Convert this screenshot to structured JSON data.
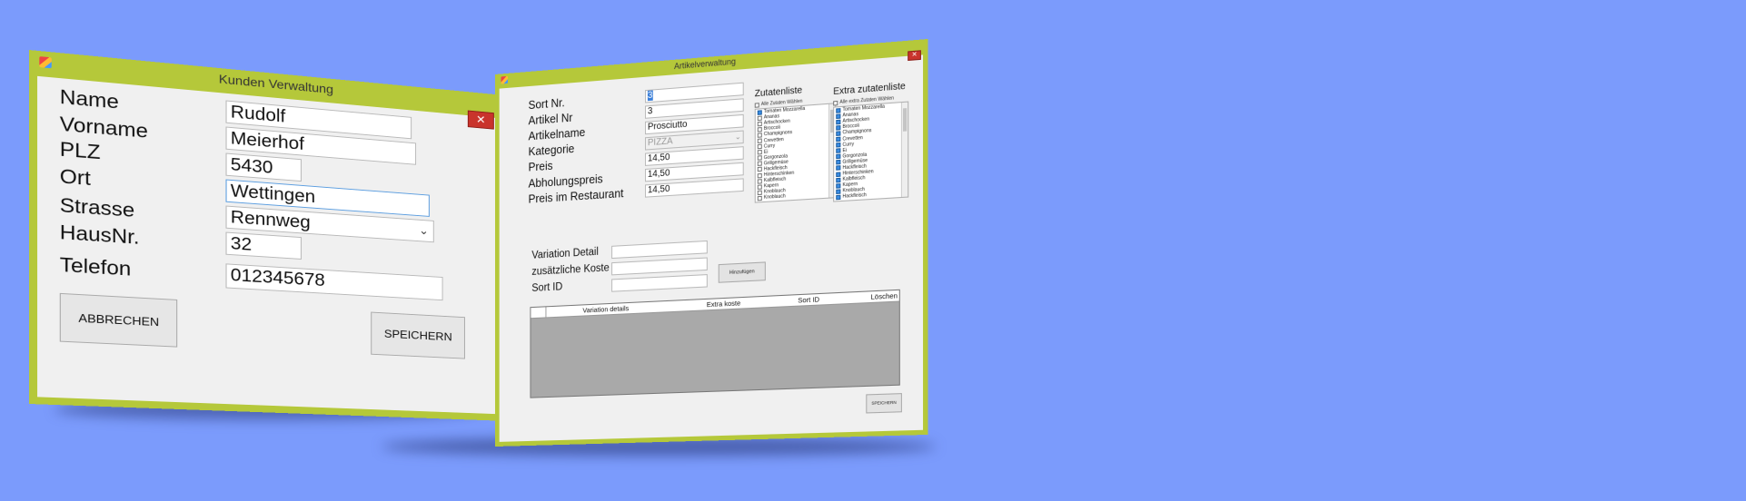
{
  "kunden": {
    "title": "Kunden Verwaltung",
    "close": "✕",
    "labels": [
      "Name",
      "Vorname",
      "PLZ",
      "Ort",
      "Strasse",
      "HausNr.",
      "Telefon"
    ],
    "values": {
      "name": "Rudolf",
      "vorname": "Meierhof",
      "plz": "5430",
      "ort": "Wettingen",
      "strasse": "Rennweg",
      "hausnr": "32",
      "telefon": "012345678"
    },
    "cancel_label": "ABBRECHEN",
    "save_label": "SPEICHERN"
  },
  "artikel": {
    "title": "Artikelverwaltung",
    "close": "✕",
    "labels": [
      "Sort Nr.",
      "Artikel Nr",
      "Artikelname",
      "Kategorie",
      "Preis",
      "Abholungspreis",
      "Preis im Restaurant"
    ],
    "values": {
      "sort_nr": "3",
      "artikel_nr": "3",
      "artikelname": "Prosciutto",
      "kategorie": "PIZZA",
      "preis": "14,50",
      "abholungspreis": "14,50",
      "preis_restaurant": "14,50"
    },
    "zutaten": {
      "title": "Zutatenliste",
      "select_all": "Alle Zutaten Wählen",
      "items": [
        {
          "label": "Tomaten Mozzarella",
          "checked": true
        },
        {
          "label": "Ananas",
          "checked": false
        },
        {
          "label": "Artischocken",
          "checked": false
        },
        {
          "label": "Broccoli",
          "checked": false
        },
        {
          "label": "Champignons",
          "checked": false
        },
        {
          "label": "Crevetten",
          "checked": false
        },
        {
          "label": "Curry",
          "checked": false
        },
        {
          "label": "Ei",
          "checked": false
        },
        {
          "label": "Gorgonzola",
          "checked": false
        },
        {
          "label": "Grillgemüse",
          "checked": false
        },
        {
          "label": "Hackfleisch",
          "checked": false
        },
        {
          "label": "Hinterschinken",
          "checked": false
        },
        {
          "label": "Kalbfleisch",
          "checked": false
        },
        {
          "label": "Kapern",
          "checked": false
        },
        {
          "label": "Knoblauch",
          "checked": false
        },
        {
          "label": "Knoblauch",
          "checked": false
        }
      ]
    },
    "extra": {
      "title": "Extra zutatenliste",
      "select_all": "Alle extra Zutaten Wählen",
      "items": [
        {
          "label": "Tomaten Mozzarella",
          "checked": true
        },
        {
          "label": "Ananas",
          "checked": true
        },
        {
          "label": "Artischocken",
          "checked": true
        },
        {
          "label": "Broccoli",
          "checked": true
        },
        {
          "label": "Champignons",
          "checked": true
        },
        {
          "label": "Crevetten",
          "checked": true
        },
        {
          "label": "Curry",
          "checked": true
        },
        {
          "label": "Ei",
          "checked": true
        },
        {
          "label": "Gorgonzola",
          "checked": true
        },
        {
          "label": "Grillgemüse",
          "checked": true
        },
        {
          "label": "Hackfleisch",
          "checked": true
        },
        {
          "label": "Hinterschinken",
          "checked": true
        },
        {
          "label": "Kalbfleisch",
          "checked": true
        },
        {
          "label": "Kapern",
          "checked": true
        },
        {
          "label": "Knoblauch",
          "checked": true
        },
        {
          "label": "Hackfleisch",
          "checked": true
        }
      ]
    },
    "variation_labels": [
      "Variation Detail",
      "zusätzliche Koste",
      "Sort ID"
    ],
    "add_label": "Hinzufügen",
    "grid_columns": [
      "Variation details",
      "Extra koste",
      "Sort ID",
      "Löschen"
    ],
    "save_label": "SPEICHERN"
  },
  "colors": {
    "background": "#7b9bfc",
    "window_border": "#b5c83a",
    "close_button": "#c9342c",
    "grid_empty": "#a9a9a9"
  }
}
